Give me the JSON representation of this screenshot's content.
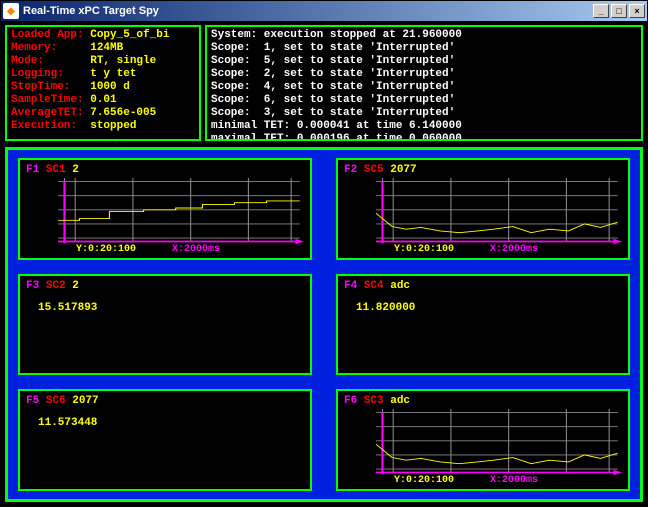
{
  "window": {
    "title": "Real-Time xPC Target Spy"
  },
  "info": {
    "rows": [
      {
        "k": "Loaded App:",
        "v": "Copy_5_of_bi"
      },
      {
        "k": "Memory:",
        "v": "124MB"
      },
      {
        "k": "Mode:",
        "v": "RT, single"
      },
      {
        "k": "Logging:",
        "v": "t y tet"
      },
      {
        "k": "StopTime:",
        "v": "1000 d"
      },
      {
        "k": "SampleTime:",
        "v": "0.01"
      },
      {
        "k": "AverageTET:",
        "v": "7.656e-005"
      },
      {
        "k": "Execution:",
        "v": "stopped"
      }
    ]
  },
  "log": "System: execution stopped at 21.960000\nScope:  1, set to state 'Interrupted'\nScope:  5, set to state 'Interrupted'\nScope:  2, set to state 'Interrupted'\nScope:  4, set to state 'Interrupted'\nScope:  6, set to state 'Interrupted'\nScope:  3, set to state 'Interrupted'\nminimal TET: 0.000041 at time 6.140000\nmaximal TET: 0.000196 at time 0.060000",
  "axis": {
    "y": "Y:0:20:100",
    "x": "X:2000ms"
  },
  "scopes": {
    "s1": {
      "fn": "F1",
      "sc": "SC1",
      "ch": "2",
      "kind": "plot",
      "series": "step"
    },
    "s2": {
      "fn": "F2",
      "sc": "SC5",
      "ch": "2077",
      "kind": "plot",
      "series": "noise"
    },
    "s3": {
      "fn": "F3",
      "sc": "SC2",
      "ch": "2",
      "kind": "value",
      "value": "15.517893"
    },
    "s4": {
      "fn": "F4",
      "sc": "SC4",
      "ch": "adc",
      "kind": "value",
      "value": "11.820000"
    },
    "s5": {
      "fn": "F5",
      "sc": "SC6",
      "ch": "2077",
      "kind": "value",
      "value": "11.573448"
    },
    "s6": {
      "fn": "F6",
      "sc": "SC3",
      "ch": "adc",
      "kind": "plot",
      "series": "noise"
    }
  },
  "chart_data": [
    {
      "type": "line",
      "scope": "SC1",
      "title": "F1 SC1 2",
      "xlabel": "X:2000ms",
      "ylabel": "Y:0:20:100",
      "ylim": [
        0,
        100
      ],
      "x_ms": [
        0,
        250,
        500,
        750,
        1000,
        1250,
        1500,
        1750,
        2000
      ],
      "y": [
        40,
        42,
        52,
        54,
        56,
        62,
        64,
        66,
        68
      ]
    },
    {
      "type": "line",
      "scope": "SC5",
      "title": "F2 SC5 2077",
      "xlabel": "X:2000ms",
      "ylabel": "Y:0:20:100",
      "ylim": [
        0,
        100
      ],
      "x_ms": [
        0,
        250,
        500,
        750,
        1000,
        1250,
        1500,
        1750,
        2000
      ],
      "y": [
        35,
        20,
        17,
        15,
        14,
        16,
        20,
        15,
        22
      ]
    },
    {
      "type": "line",
      "scope": "SC3",
      "title": "F6 SC3 adc",
      "xlabel": "X:2000ms",
      "ylabel": "Y:0:20:100",
      "ylim": [
        0,
        100
      ],
      "x_ms": [
        0,
        250,
        500,
        750,
        1000,
        1250,
        1500,
        1750,
        2000
      ],
      "y": [
        35,
        20,
        17,
        15,
        14,
        16,
        20,
        15,
        22
      ]
    }
  ]
}
